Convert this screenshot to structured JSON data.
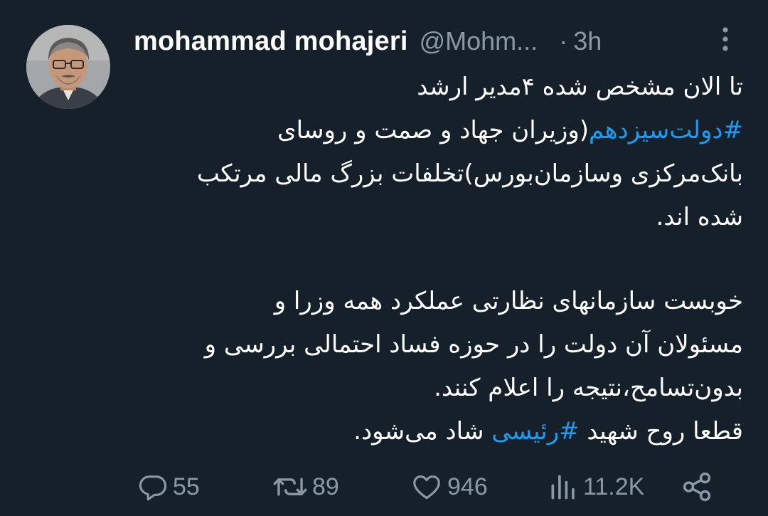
{
  "author": {
    "name": "mohammad mohajeri",
    "handle": "@Mohm...",
    "separator": "·",
    "time": "3h"
  },
  "tweet": {
    "line1": "تا الان مشخص شده ۴مدیر ارشد",
    "line2_hashtag": "#دولت‌سیزدهم",
    "line2_rest": "(وزیران جهاد و صمت و روسای",
    "line3": "بانک‌مرکزی وسازمان‌بورس)تخلفات بزرگ مالی مرتکب",
    "line4": "شده اند.",
    "line5": " خوبست سازمانهای نظارتی عملکرد همه وزرا و",
    "line6": "مسئولان آن دولت را در حوزه فساد احتمالی بررسی و",
    "line7": "بدون‌تسامح،نتیجه را اعلام کنند.",
    "line8_before": " قطعا روح شهید ",
    "line8_hashtag": "#رئیسی",
    "line8_after": " شاد می‌شود."
  },
  "actions": {
    "replies": "55",
    "retweets": "89",
    "likes": "946",
    "views": "11.2K"
  },
  "icons": [
    "reply-icon",
    "retweet-icon",
    "like-icon",
    "views-icon",
    "share-icon",
    "more-icon"
  ],
  "colors": {
    "background": "#15202b",
    "text": "#ffffff",
    "secondary": "#8b98a5",
    "link": "#1d9bf0"
  }
}
